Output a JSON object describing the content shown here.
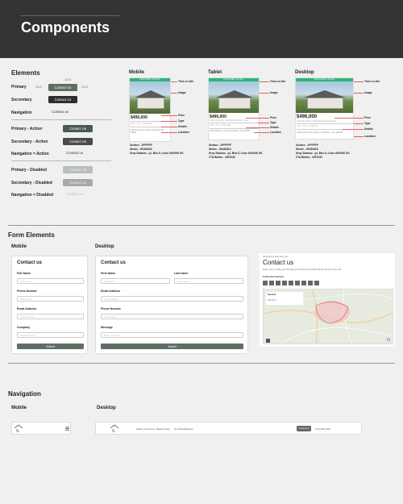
{
  "page_title": "Components",
  "elements": {
    "heading": "Elements",
    "rows": [
      {
        "label": "Primary",
        "button": "Contact Us"
      },
      {
        "label": "Secondary",
        "button": "Contact Us"
      },
      {
        "label": "Navigation",
        "button": "Contact us"
      },
      {
        "label": "Primary - Action",
        "button": "Contact Us"
      },
      {
        "label": "Secondary - Action",
        "button": "Contact Us"
      },
      {
        "label": "Navigation = Action",
        "button": "Contact us"
      },
      {
        "label": "Primary - Disabled",
        "button": "Contact Us"
      },
      {
        "label": "Secondary - Disabled",
        "button": "Contact Us"
      },
      {
        "label": "Navigation = Disabled",
        "button": "Contact us"
      }
    ],
    "spec_top": "16.00",
    "spec_left": "24.00",
    "spec_right": "24.00"
  },
  "cards": {
    "banner": "FEATURED LISTING",
    "price": "$496,000",
    "type": "SINGLE FAMILY RESIDENCE FOR SALE",
    "details": "3 bd · 3 ba · 2,304 sqft",
    "location": "1234 Oak Tree Grove Charlotte, NC 28105",
    "columns": [
      {
        "title": "Mobile",
        "surface": "Surface - #FFFFFF",
        "stroke": "Stroke - #EAEAEA",
        "shadow": "Drop Shadow - y4, Blur 8, Color #000000 8%",
        "cta": ""
      },
      {
        "title": "Tablet",
        "surface": "Surface - #FFFFFF",
        "stroke": "Stroke - #EAEAEA",
        "shadow": "Drop Shadow - y4, Blur 8, Color #000000 8%",
        "cta": "CTA Button - #6F1030"
      },
      {
        "title": "Desktop",
        "surface": "Surface - #FFFFFF",
        "stroke": "Stroke - #EAEAEA",
        "shadow": "Drop Shadow - y4, Blur 8, Color #000000 8%",
        "cta": "CTA Button - #6F1030"
      }
    ],
    "annotations": [
      "Time on site",
      "Image",
      "Price",
      "Type",
      "Details",
      "Location"
    ]
  },
  "forms": {
    "heading": "Form Elements",
    "mobile_title": "Mobile",
    "desktop_title": "Desktop",
    "form_title": "Contact us",
    "fields": {
      "full_name": "Full Name",
      "first_name": "First Name",
      "last_name": "Last name",
      "phone": "Phone Number",
      "email": "Email Address",
      "company": "Company",
      "message": "Message"
    },
    "placeholders": {
      "full_name": "Enter name",
      "first_name": "First name",
      "last_name": "Last name",
      "phone": "Enter phone",
      "email": "Email address",
      "company": "Company name",
      "message": "Enter message"
    },
    "submit": "Submit",
    "map": {
      "kicker": "We'd love to hear from you",
      "title": "Contact us",
      "description": "Reach out to us, Take your first steps in the world of real estate with the expert you can trust",
      "follow": "Follow Our Channels",
      "pin_title": "Neuland",
      "pin_sub": "Directions"
    }
  },
  "navigation": {
    "heading": "Navigation",
    "mobile_title": "Mobile",
    "desktop_title": "Desktop",
    "items": [
      "Selling Your Home",
      "Buying Today",
      "Our Work/Reviews"
    ],
    "cta": "Contact Us",
    "phone": "(704) 555-0123"
  },
  "colors": {
    "primary": "#5f6e62",
    "secondary": "#2d2d2d",
    "banner": "#2bb673",
    "hero": "#333333"
  }
}
